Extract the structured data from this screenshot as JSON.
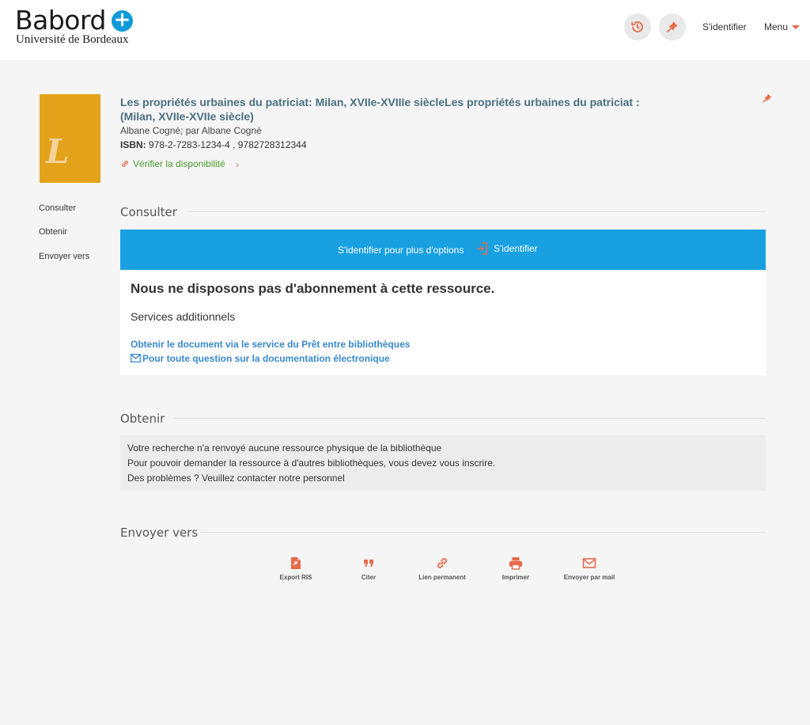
{
  "header": {
    "logo_word": "Babord",
    "logo_plus": "+",
    "logo_subtitle": "Université de Bordeaux",
    "signin_label": "S'identifier",
    "menu_label": "Menu"
  },
  "record": {
    "cover_letter": "L",
    "title": "Les propriétés urbaines du patriciat: Milan, XVIIe-XVIIIe siècleLes propriétés urbaines du patriciat : (Milan, XVIIe-XVIIe siècle)",
    "author": "Albane Cogné; par Albane Cogné",
    "isbn_label": "ISBN:",
    "isbn_value": " 978-2-7283-1234-4 , 9782728312344",
    "availability_label": "Vérifier la disponibilité",
    "availability_chevron": "›"
  },
  "leftnav": {
    "items": [
      "Consulter",
      "Obtenir",
      "Envoyer vers"
    ]
  },
  "consulter": {
    "section_title": "Consulter",
    "login_prompt": "S'identifier pour plus d'options",
    "login_button": "S'identifier",
    "no_subscription": "Nous ne disposons pas d'abonnement à cette ressource.",
    "services_title": "Services additionnels",
    "pib_link": "Obtenir le document via le service du Prêt entre bibliothèques",
    "doc_link": "Pour toute question sur la documentation électronique"
  },
  "obtenir": {
    "section_title": "Obtenir",
    "lines": [
      "Votre recherche n'a renvoyé aucune ressource physique de la bibliothèque",
      "Pour pouvoir demander la ressource à d'autres bibliothèques, vous devez vous inscrire.",
      "Des problèmes ? Veuillez contacter notre personnel"
    ]
  },
  "envoyer": {
    "section_title": "Envoyer vers",
    "items": [
      {
        "label": "Export RIS",
        "icon": "file-export-icon"
      },
      {
        "label": "Citer",
        "icon": "quote-icon"
      },
      {
        "label": "Lien permanent",
        "icon": "link-icon"
      },
      {
        "label": "Imprimer",
        "icon": "printer-icon"
      },
      {
        "label": "Envoyer par mail",
        "icon": "envelope-icon"
      }
    ]
  },
  "colors": {
    "accent_orange": "#e76a4a",
    "login_blue": "#18a0e0",
    "title_teal": "#4a6f7f",
    "link_blue": "#3a88cc",
    "avail_green": "#4a9a2e",
    "cover_gold": "#e3a21a",
    "logo_blue": "#0f9ad8"
  }
}
